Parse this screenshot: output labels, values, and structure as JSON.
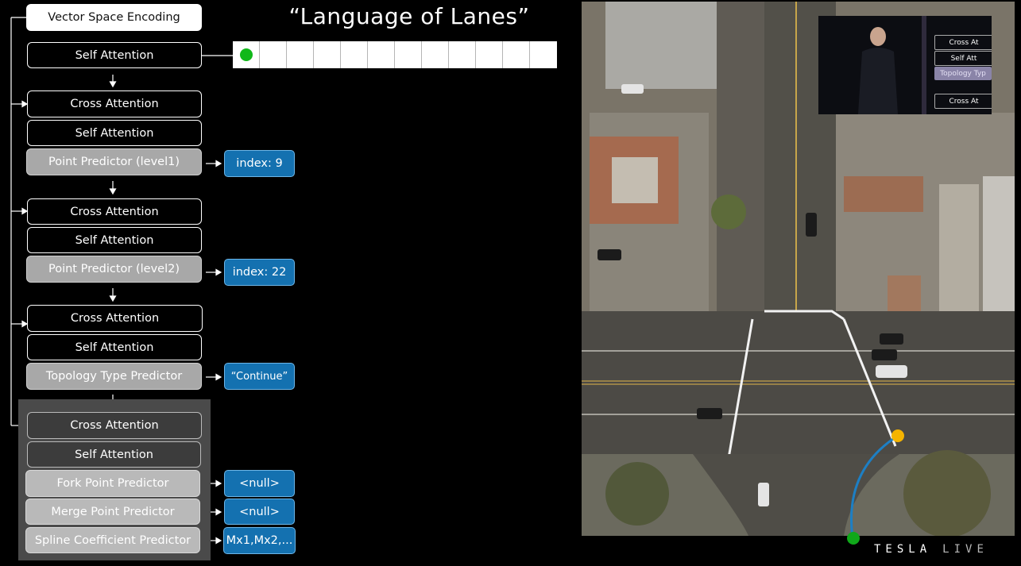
{
  "slide": {
    "title": "“Language of Lanes”",
    "vector_space_encoding": "Vector Space Encoding",
    "self_attention_top": "Self Attention",
    "sequence_cells": 12
  },
  "blocks": [
    {
      "cross": "Cross Attention",
      "self": "Self Attention",
      "predictor": "Point Predictor (level1)",
      "output": "index: 9"
    },
    {
      "cross": "Cross Attention",
      "self": "Self Attention",
      "predictor": "Point Predictor (level2)",
      "output": "index: 22"
    },
    {
      "cross": "Cross Attention",
      "self": "Self Attention",
      "predictor": "Topology Type Predictor",
      "output": "“Continue”"
    }
  ],
  "final_block": {
    "cross": "Cross Attention",
    "self": "Self Attention",
    "predictors": [
      {
        "label": "Fork Point Predictor",
        "output": "<null>"
      },
      {
        "label": "Merge Point Predictor",
        "output": "<null>"
      },
      {
        "label": "Spline Coefficient Predictor",
        "output": "Mx1,Mx2,..."
      }
    ]
  },
  "inset": {
    "items": [
      "Cross At",
      "Self Att",
      "Topology Typ",
      "Cross At"
    ]
  },
  "brand": {
    "name": "TESLA",
    "suffix": "LIVE"
  },
  "colors": {
    "background": "#000000",
    "output_blue": "#1471b0",
    "sequence_dot_green": "#11b81a",
    "start_point_green": "#10a81a",
    "end_point_yellow": "#f5b400",
    "spline_blue": "#1d7fc4"
  }
}
